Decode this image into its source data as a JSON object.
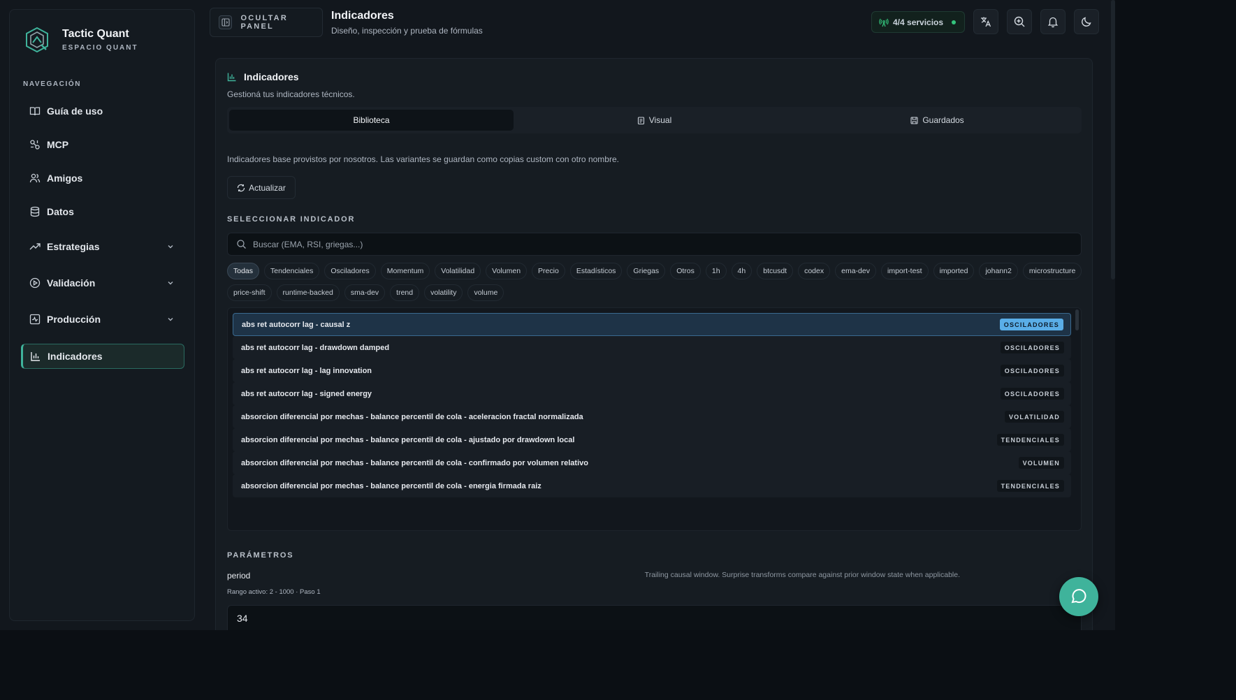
{
  "brand": {
    "title": "Tactic Quant",
    "subtitle": "ESPACIO QUANT"
  },
  "sidebar": {
    "heading": "NAVEGACIÓN",
    "items": [
      {
        "label": "Guía de uso",
        "icon": "book-open-icon"
      },
      {
        "label": "MCP",
        "icon": "mcp-icon"
      },
      {
        "label": "Amigos",
        "icon": "users-icon"
      },
      {
        "label": "Datos",
        "icon": "database-icon"
      },
      {
        "label": "Estrategias",
        "icon": "trending-up-icon",
        "expandable": true
      },
      {
        "label": "Validación",
        "icon": "play-circle-icon",
        "expandable": true
      },
      {
        "label": "Producción",
        "icon": "activity-square-icon",
        "expandable": true
      },
      {
        "label": "Indicadores",
        "icon": "bar-chart-icon",
        "active": true
      }
    ]
  },
  "topbar": {
    "panel_button": "OCULTAR PANEL",
    "title": "Indicadores",
    "subtitle": "Diseño, inspección y prueba de fórmulas",
    "status": "4/4 servicios"
  },
  "card": {
    "title": "Indicadores",
    "subtitle": "Gestioná tus indicadores técnicos.",
    "tabs": [
      {
        "label": "Biblioteca",
        "active": true
      },
      {
        "label": "Visual"
      },
      {
        "label": "Guardados"
      }
    ],
    "description": "Indicadores base provistos por nosotros. Las variantes se guardan como copias custom con otro nombre.",
    "refresh_button": "Actualizar"
  },
  "selector": {
    "label": "SELECCIONAR INDICADOR",
    "search_placeholder": "Buscar (EMA, RSI, griegas...)",
    "chips_row1": [
      "Todas",
      "Tendenciales",
      "Osciladores",
      "Momentum",
      "Volatilidad",
      "Volumen",
      "Precio",
      "Estadísticos",
      "Griegas",
      "Otros",
      "1h",
      "4h",
      "btcusdt",
      "codex",
      "ema-dev",
      "import-test",
      "imported",
      "johann2",
      "microstructure"
    ],
    "chips_row2": [
      "price-shift",
      "runtime-backed",
      "sma-dev",
      "trend",
      "volatility",
      "volume"
    ],
    "items": [
      {
        "name": "abs ret autocorr lag - causal z",
        "category": "OSCILADORES",
        "selected": true
      },
      {
        "name": "abs ret autocorr lag - drawdown damped",
        "category": "OSCILADORES"
      },
      {
        "name": "abs ret autocorr lag - lag innovation",
        "category": "OSCILADORES"
      },
      {
        "name": "abs ret autocorr lag - signed energy",
        "category": "OSCILADORES"
      },
      {
        "name": "absorcion diferencial por mechas - balance percentil de cola - aceleracion fractal normalizada",
        "category": "VOLATILIDAD"
      },
      {
        "name": "absorcion diferencial por mechas - balance percentil de cola - ajustado por drawdown local",
        "category": "TENDENCIALES"
      },
      {
        "name": "absorcion diferencial por mechas - balance percentil de cola - confirmado por volumen relativo",
        "category": "VOLUMEN"
      },
      {
        "name": "absorcion diferencial por mechas - balance percentil de cola - energia firmada raiz",
        "category": "TENDENCIALES"
      }
    ]
  },
  "parameters": {
    "label": "PARÁMETROS",
    "name": "period",
    "help": "Trailing causal window. Surprise transforms compare against prior window state when applicable.",
    "range": "Rango activo: 2 - 1000 · Paso 1",
    "value": "34"
  },
  "colors": {
    "accent": "#3fb39b",
    "selected": "#5aaee8",
    "status_ok": "#34c47c"
  }
}
